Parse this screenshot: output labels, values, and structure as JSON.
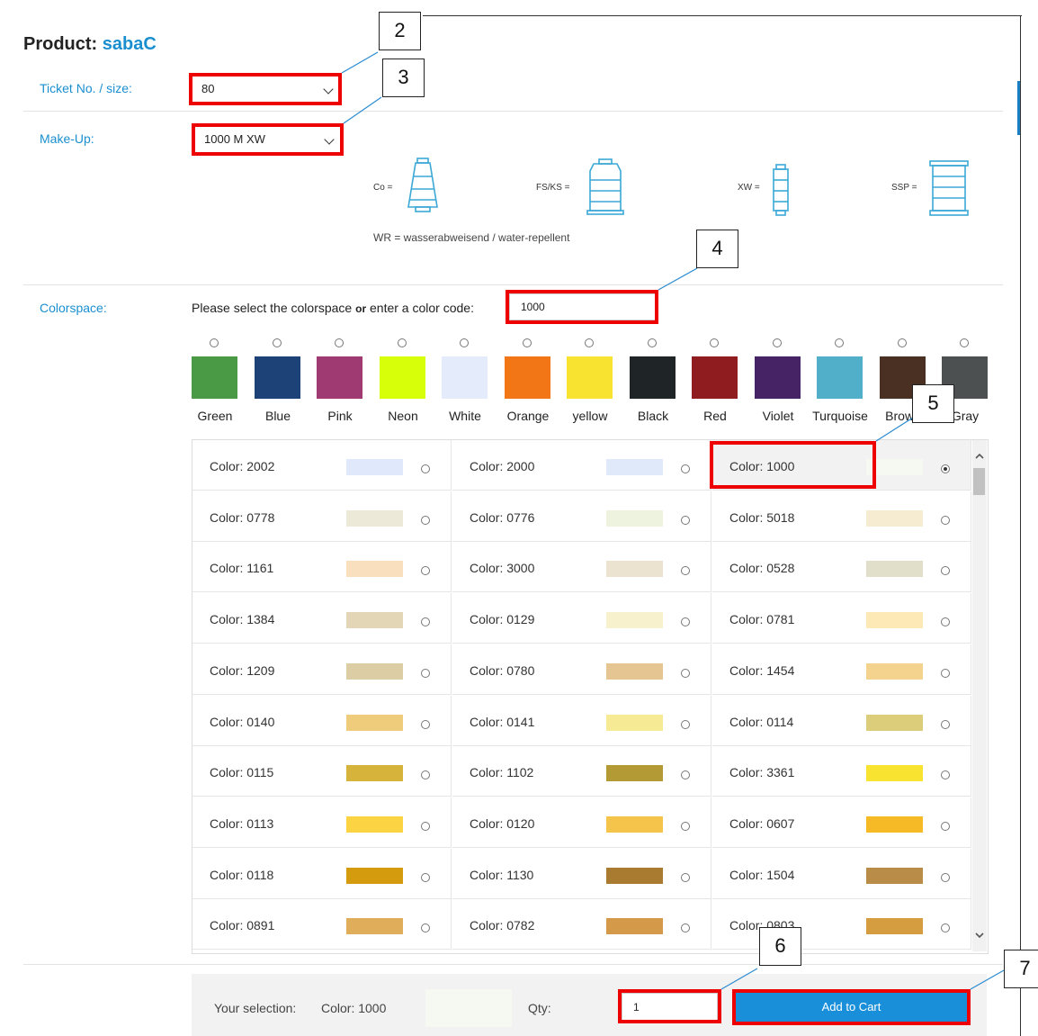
{
  "product": {
    "label": "Product:",
    "name": "sabaC"
  },
  "ticket": {
    "label": "Ticket No. / size:",
    "value": "80"
  },
  "makeup": {
    "label": "Make-Up:",
    "value": "1000 M XW"
  },
  "legend": {
    "items": [
      {
        "label": "Co ="
      },
      {
        "label": "FS/KS ="
      },
      {
        "label": "XW ="
      },
      {
        "label": "SSP ="
      }
    ],
    "note": "WR = wasserabweisend / water-repellent"
  },
  "colorspace": {
    "label": "Colorspace:",
    "prompt_a": "Please select the colorspace ",
    "prompt_or": "or",
    "prompt_b": " enter a color code:",
    "code_value": "1000",
    "swatches": [
      {
        "name": "Green",
        "color": "#4a9a45"
      },
      {
        "name": "Blue",
        "color": "#1c4278"
      },
      {
        "name": "Pink",
        "color": "#a03a72"
      },
      {
        "name": "Neon",
        "color": "#d8ff0a"
      },
      {
        "name": "White",
        "color": "#e4ecfb"
      },
      {
        "name": "Orange",
        "color": "#f27516"
      },
      {
        "name": "yellow",
        "color": "#f8e430"
      },
      {
        "name": "Black",
        "color": "#1f2426"
      },
      {
        "name": "Red",
        "color": "#8f1c1e"
      },
      {
        "name": "Violet",
        "color": "#452365"
      },
      {
        "name": "Turquoise",
        "color": "#52afca"
      },
      {
        "name": "Brown",
        "color": "#4a3022"
      },
      {
        "name": "Gray",
        "color": "#4c5050"
      }
    ]
  },
  "colors": [
    {
      "label": "Color: 2002",
      "color": "#e0e8fb"
    },
    {
      "label": "Color: 2000",
      "color": "#e0e9fa"
    },
    {
      "label": "Color: 1000",
      "color": "#f6f9f1",
      "selected": true
    },
    {
      "label": "Color: 0778",
      "color": "#ede9d9"
    },
    {
      "label": "Color: 0776",
      "color": "#eef3e0"
    },
    {
      "label": "Color: 5018",
      "color": "#f6ecd2"
    },
    {
      "label": "Color: 1161",
      "color": "#f9dfbd"
    },
    {
      "label": "Color: 3000",
      "color": "#ebe2cf"
    },
    {
      "label": "Color: 0528",
      "color": "#e1dec9"
    },
    {
      "label": "Color: 1384",
      "color": "#e2d6b7"
    },
    {
      "label": "Color: 0129",
      "color": "#f7f1ce"
    },
    {
      "label": "Color: 0781",
      "color": "#fde9b5"
    },
    {
      "label": "Color: 1209",
      "color": "#ddcda5"
    },
    {
      "label": "Color: 0780",
      "color": "#e5c592"
    },
    {
      "label": "Color: 1454",
      "color": "#f4d38f"
    },
    {
      "label": "Color: 0140",
      "color": "#efcc7c"
    },
    {
      "label": "Color: 0141",
      "color": "#f6ea94"
    },
    {
      "label": "Color: 0114",
      "color": "#dccd7b"
    },
    {
      "label": "Color: 0115",
      "color": "#d6b43c"
    },
    {
      "label": "Color: 1102",
      "color": "#b39a34"
    },
    {
      "label": "Color: 3361",
      "color": "#f8e330"
    },
    {
      "label": "Color: 0113",
      "color": "#fcd443"
    },
    {
      "label": "Color: 0120",
      "color": "#f5c44a"
    },
    {
      "label": "Color: 0607",
      "color": "#f6ba26"
    },
    {
      "label": "Color: 0118",
      "color": "#d49b0e"
    },
    {
      "label": "Color: 1130",
      "color": "#a97b31"
    },
    {
      "label": "Color: 1504",
      "color": "#b98d47"
    },
    {
      "label": "Color: 0891",
      "color": "#e0ae5a"
    },
    {
      "label": "Color: 0782",
      "color": "#d59a49"
    },
    {
      "label": "Color: 0803",
      "color": "#d69c40"
    }
  ],
  "selection": {
    "label": "Your selection:",
    "value": "Color: 1000",
    "swatch_color": "#f6f9f1",
    "qty_label": "Qty:",
    "qty_value": "1",
    "add_label": "Add to Cart"
  },
  "callouts": [
    "2",
    "3",
    "4",
    "5",
    "6",
    "7"
  ]
}
